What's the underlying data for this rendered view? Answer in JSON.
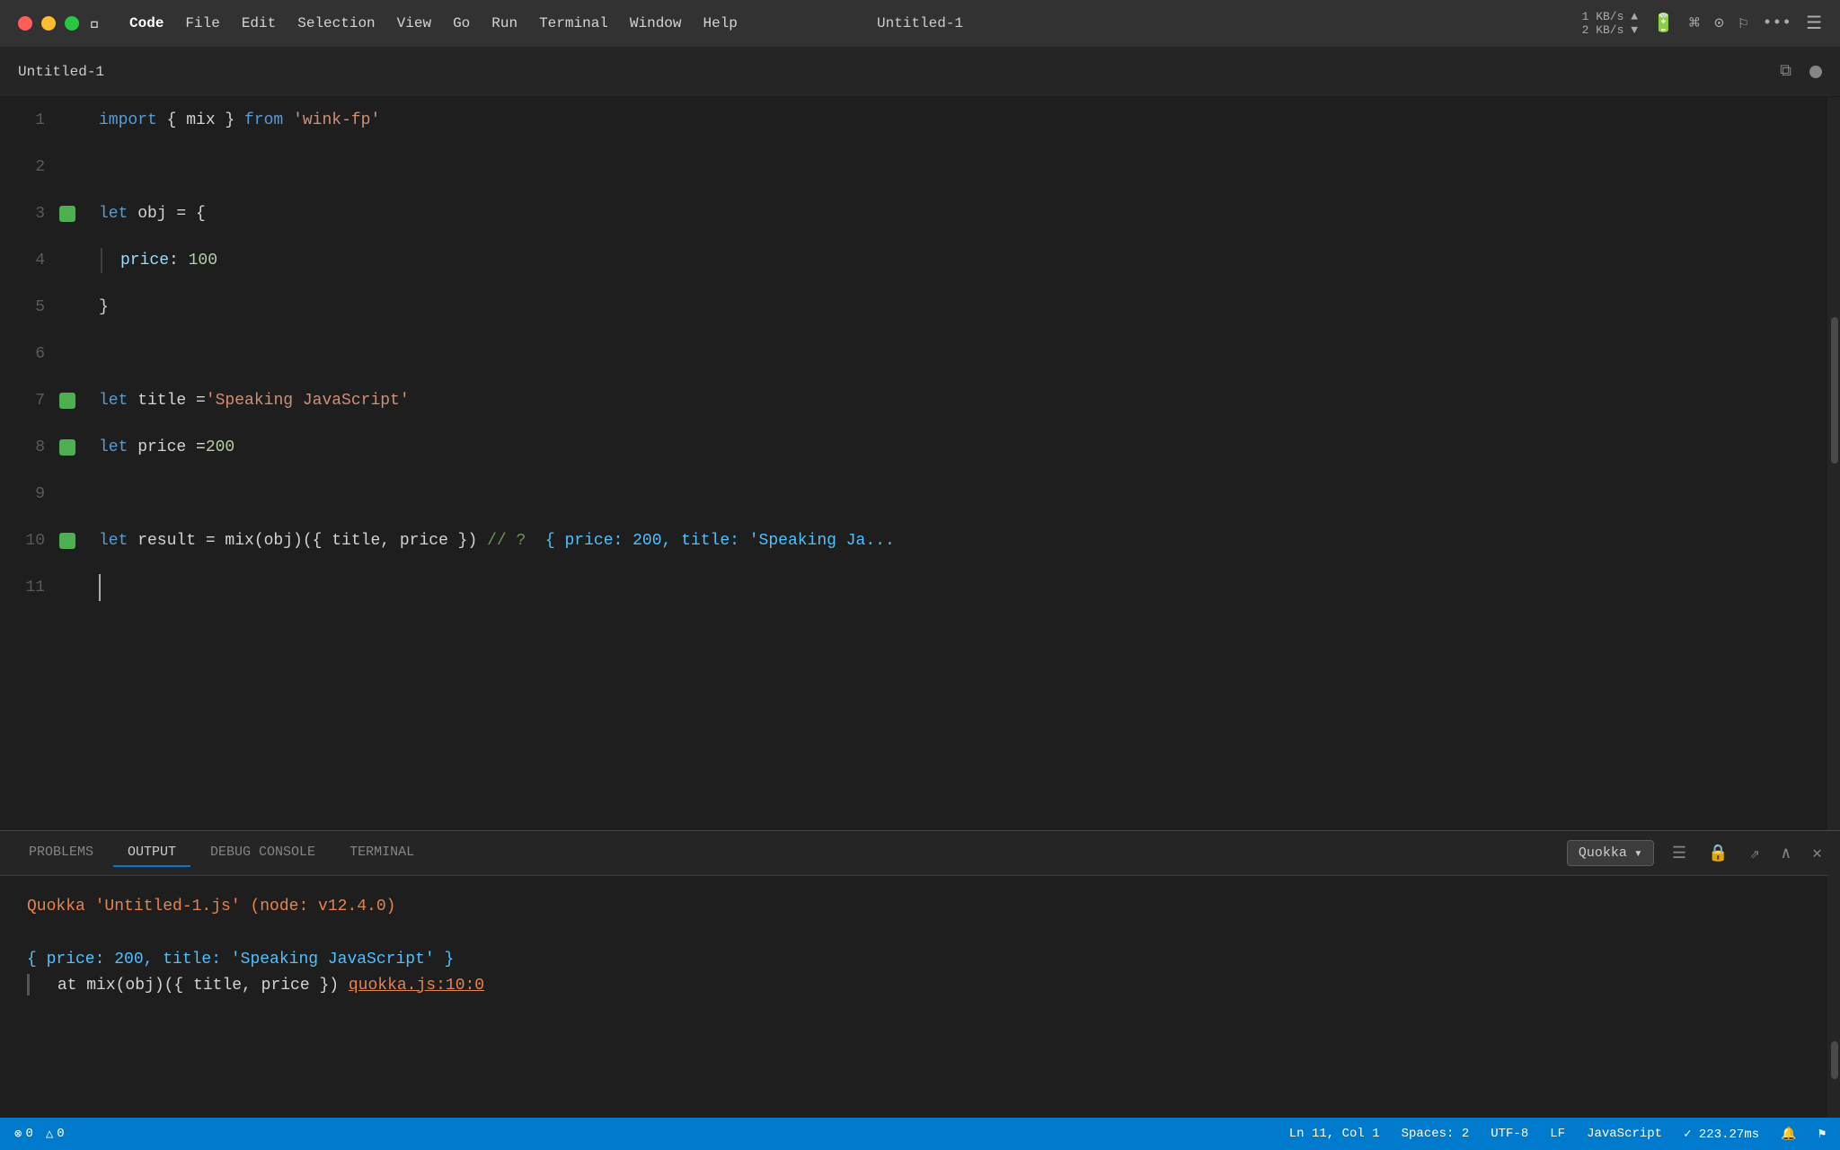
{
  "titlebar": {
    "title": "Untitled-1",
    "menus": [
      "",
      "Code",
      "File",
      "Edit",
      "Selection",
      "View",
      "Go",
      "Run",
      "Terminal",
      "Window",
      "Help"
    ],
    "network": "1 KB/s ▲  2 KB/s ▼"
  },
  "editor": {
    "tab_title": "Untitled-1",
    "lines": [
      {
        "num": "1",
        "tokens": [
          {
            "t": "import",
            "c": "kw"
          },
          {
            "t": " { ",
            "c": "punc"
          },
          {
            "t": "mix",
            "c": "plain"
          },
          {
            "t": " } ",
            "c": "punc"
          },
          {
            "t": "from",
            "c": "kw"
          },
          {
            "t": " ",
            "c": "plain"
          },
          {
            "t": "'wink-fp'",
            "c": "str"
          }
        ]
      },
      {
        "num": "2",
        "tokens": []
      },
      {
        "num": "3",
        "gutter_dot": true,
        "tokens": [
          {
            "t": "let",
            "c": "kw"
          },
          {
            "t": " obj = {",
            "c": "plain"
          }
        ]
      },
      {
        "num": "4",
        "indent_bar": true,
        "tokens": [
          {
            "t": "price",
            "c": "prop"
          },
          {
            "t": ": ",
            "c": "plain"
          },
          {
            "t": "100",
            "c": "num"
          }
        ]
      },
      {
        "num": "5",
        "tokens": [
          {
            "t": "}",
            "c": "plain"
          }
        ]
      },
      {
        "num": "6",
        "tokens": []
      },
      {
        "num": "7",
        "gutter_dot": true,
        "tokens": [
          {
            "t": "let",
            "c": "kw"
          },
          {
            "t": " title = ",
            "c": "plain"
          },
          {
            "t": "'Speaking JavaScript'",
            "c": "str"
          }
        ]
      },
      {
        "num": "8",
        "gutter_dot": true,
        "tokens": [
          {
            "t": "let",
            "c": "kw"
          },
          {
            "t": " price = ",
            "c": "plain"
          },
          {
            "t": "200",
            "c": "num"
          }
        ]
      },
      {
        "num": "9",
        "tokens": []
      },
      {
        "num": "10",
        "gutter_dot": true,
        "tokens": [
          {
            "t": "let",
            "c": "kw"
          },
          {
            "t": " result = mix(obj)({ title, price })  // ?  { price: 200, title: 'Speaking Ja...",
            "c": "plain_result"
          }
        ]
      },
      {
        "num": "11",
        "tokens": []
      }
    ]
  },
  "panel": {
    "tabs": [
      "PROBLEMS",
      "OUTPUT",
      "DEBUG CONSOLE",
      "TERMINAL"
    ],
    "active_tab": "OUTPUT",
    "selector": "Quokka",
    "output_lines": [
      "Quokka 'Untitled-1.js' (node: v12.4.0)",
      "",
      "{ price: 200, title: 'Speaking JavaScript' }",
      "  at mix(obj)({ title, price }) quokka.js:10:0"
    ]
  },
  "statusbar": {
    "errors": "0",
    "warnings": "0",
    "position": "Ln 11, Col 1",
    "spaces": "Spaces: 2",
    "encoding": "UTF-8",
    "line_ending": "LF",
    "language": "JavaScript",
    "timing": "✓ 223.27ms"
  }
}
